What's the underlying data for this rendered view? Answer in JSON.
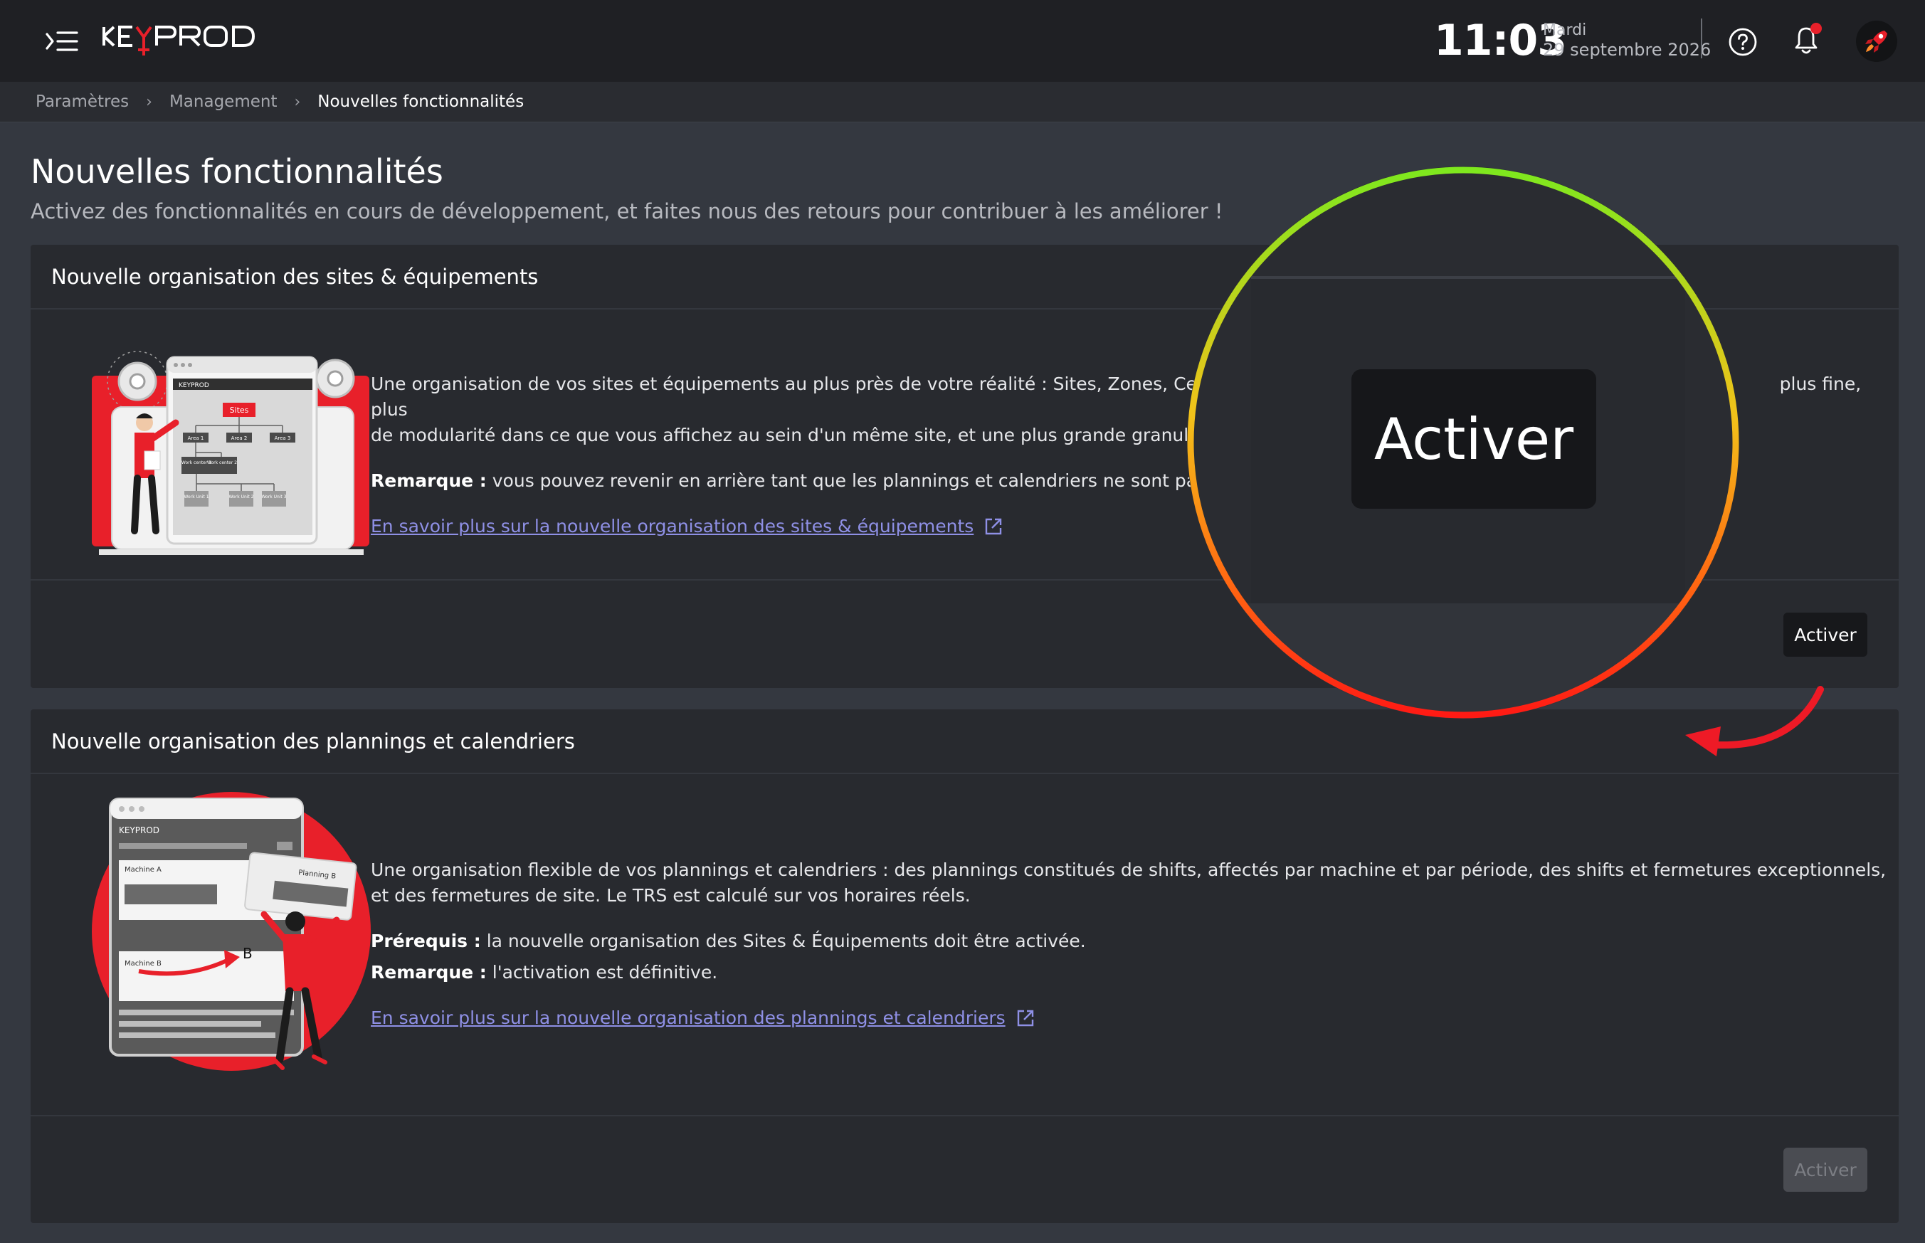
{
  "header": {
    "logo_text": "KEYPROD",
    "time": "11:03",
    "day": "Mardi",
    "date": "29 septembre 2026",
    "icons": [
      "menu-toggle-icon",
      "help-icon",
      "bell-icon",
      "rocket-icon"
    ],
    "accent_color": "#e8202a"
  },
  "breadcrumb": [
    "Paramètres",
    "Management",
    "Nouvelles fonctionnalités"
  ],
  "page": {
    "title": "Nouvelles fonctionnalités",
    "subtitle": "Activez des fonctionnalités en cours de développement, et faites nous des retours pour contribuer à les améliorer !"
  },
  "features": [
    {
      "title": "Nouvelle organisation des sites & équipements",
      "description": "Une organisation de vos sites et équipements au plus près de votre réalité : Sites, Zones, Centre",
      "description_tail": "plus fine, plus",
      "description_line2": "de modularité dans ce que vous affichez au sein d'un même site, et une plus grande granularité",
      "remark_label": "Remarque :",
      "remark_text": "vous pouvez revenir en arrière tant que les plannings et calendriers ne sont pas ac",
      "link": "En savoir plus sur la nouvelle organisation des sites & équipements",
      "button": "Activer",
      "button_enabled": true,
      "illustration_labels": {
        "logo": "KEYPROD",
        "root": "Sites",
        "areas": [
          "Area 1",
          "Area 2",
          "Area 3"
        ],
        "centers": [
          "Work center 1",
          "Work center 2"
        ],
        "units": [
          "Work Unit 1",
          "Work Unit 2",
          "Work Unit 3"
        ]
      }
    },
    {
      "title": "Nouvelle organisation des plannings et calendriers",
      "description": "Une organisation flexible de vos plannings et calendriers : des plannings constitués de shifts, affectés par machine et par période, des shifts et fermetures exceptionnels, et des fermetures de site. Le TRS est calculé sur vos horaires réels.",
      "prereq_label": "Prérequis :",
      "prereq_text": "la nouvelle organisation des Sites & Équipements doit être activée.",
      "remark_label": "Remarque :",
      "remark_text": "l'activation est définitive.",
      "link": "En savoir plus sur la nouvelle organisation des plannings et calendriers",
      "button": "Activer",
      "button_enabled": false,
      "illustration_labels": {
        "logo": "KEYPROD",
        "machine_a": "Machine A",
        "machine_b": "Machine B",
        "planning_b": "Planning B",
        "letter": "B"
      }
    }
  ],
  "callout": {
    "zoom_label": "Activer"
  }
}
